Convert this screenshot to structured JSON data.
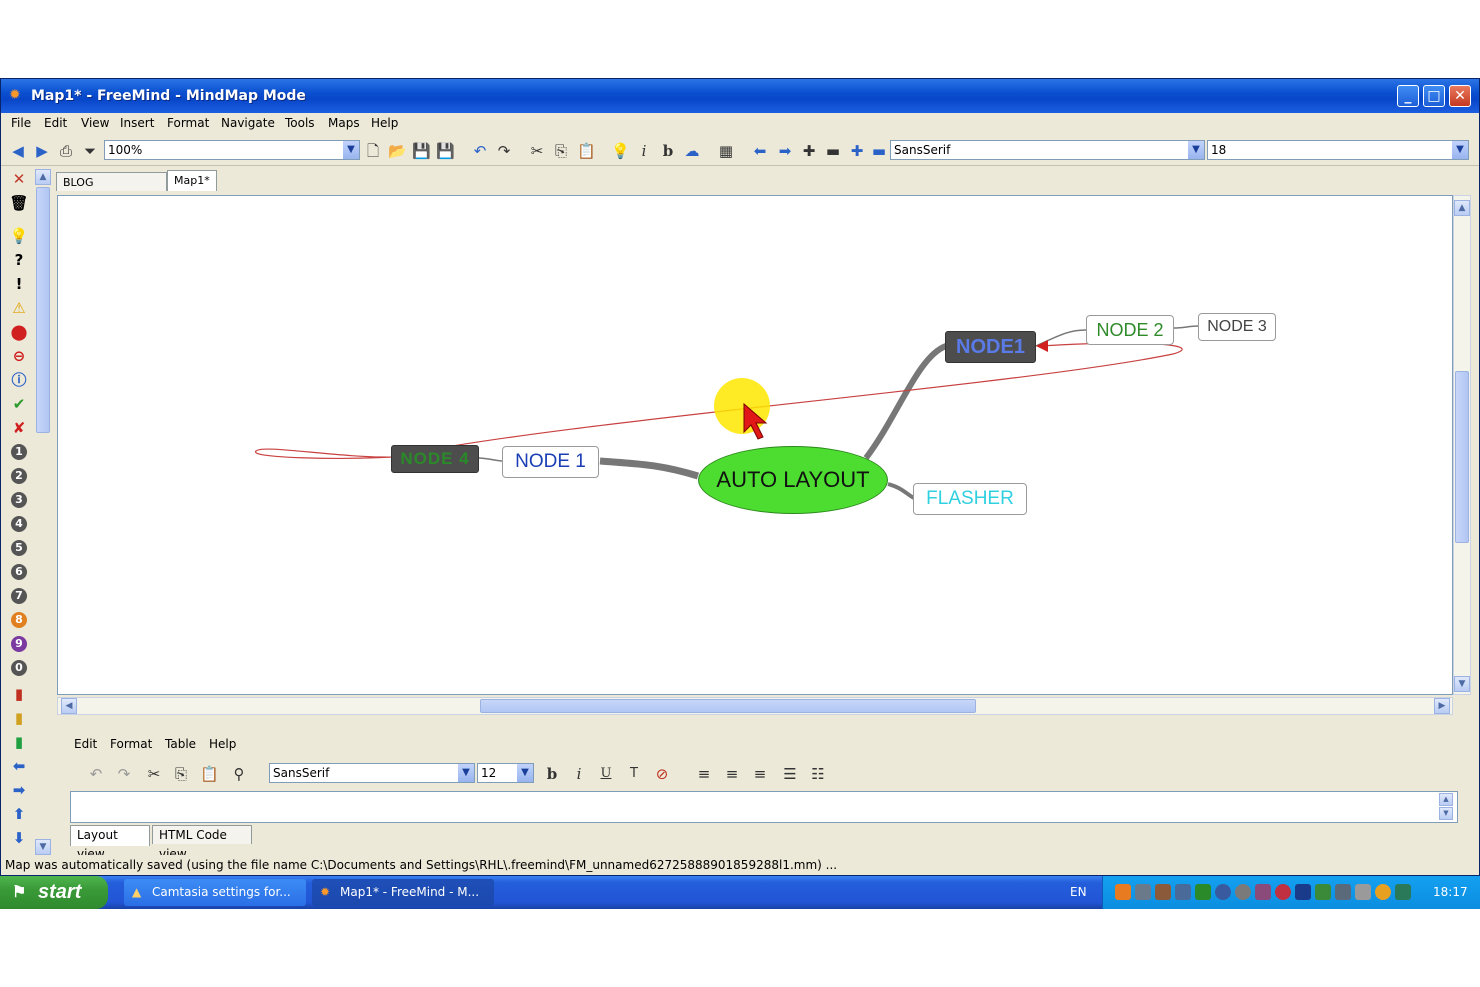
{
  "window": {
    "title": "Map1* - FreeMind - MindMap Mode"
  },
  "menu": [
    "File",
    "Edit",
    "View",
    "Insert",
    "Format",
    "Navigate",
    "Tools",
    "Maps",
    "Help"
  ],
  "toolbar": {
    "zoom": "100%",
    "font": "SansSerif",
    "font_size": "18"
  },
  "tabs": [
    {
      "label": "BLOG TOPICS.mm",
      "active": false
    },
    {
      "label": "Map1*",
      "active": true
    }
  ],
  "mindmap": {
    "root": "AUTO LAYOUT",
    "node1_dark": "NODE1",
    "node2": "NODE 2",
    "node3": "NODE 3",
    "node1_box": "NODE 1",
    "node_left_dark": "NODE 4",
    "flasher": "FLASHER"
  },
  "colors": {
    "root_fill": "#4ddd30",
    "node_blue": "#1a3fb4",
    "node_green": "#2f8a2a",
    "flasher": "#2fd0e0",
    "link_red": "#c84040"
  },
  "editor": {
    "menu": [
      "Edit",
      "Format",
      "Table",
      "Help"
    ],
    "font": "SansSerif",
    "font_size": "12",
    "tabs": [
      "Layout view",
      "HTML Code view"
    ]
  },
  "status": "Map was automatically saved (using the file name C:\\Documents and Settings\\RHL\\.freemind\\FM_unnamed62725888901859288l1.mm) ...",
  "taskbar": {
    "start": "start",
    "buttons": [
      "Camtasia settings for...",
      "Map1* - FreeMind - M..."
    ],
    "lang": "EN",
    "clock": "18:17"
  }
}
